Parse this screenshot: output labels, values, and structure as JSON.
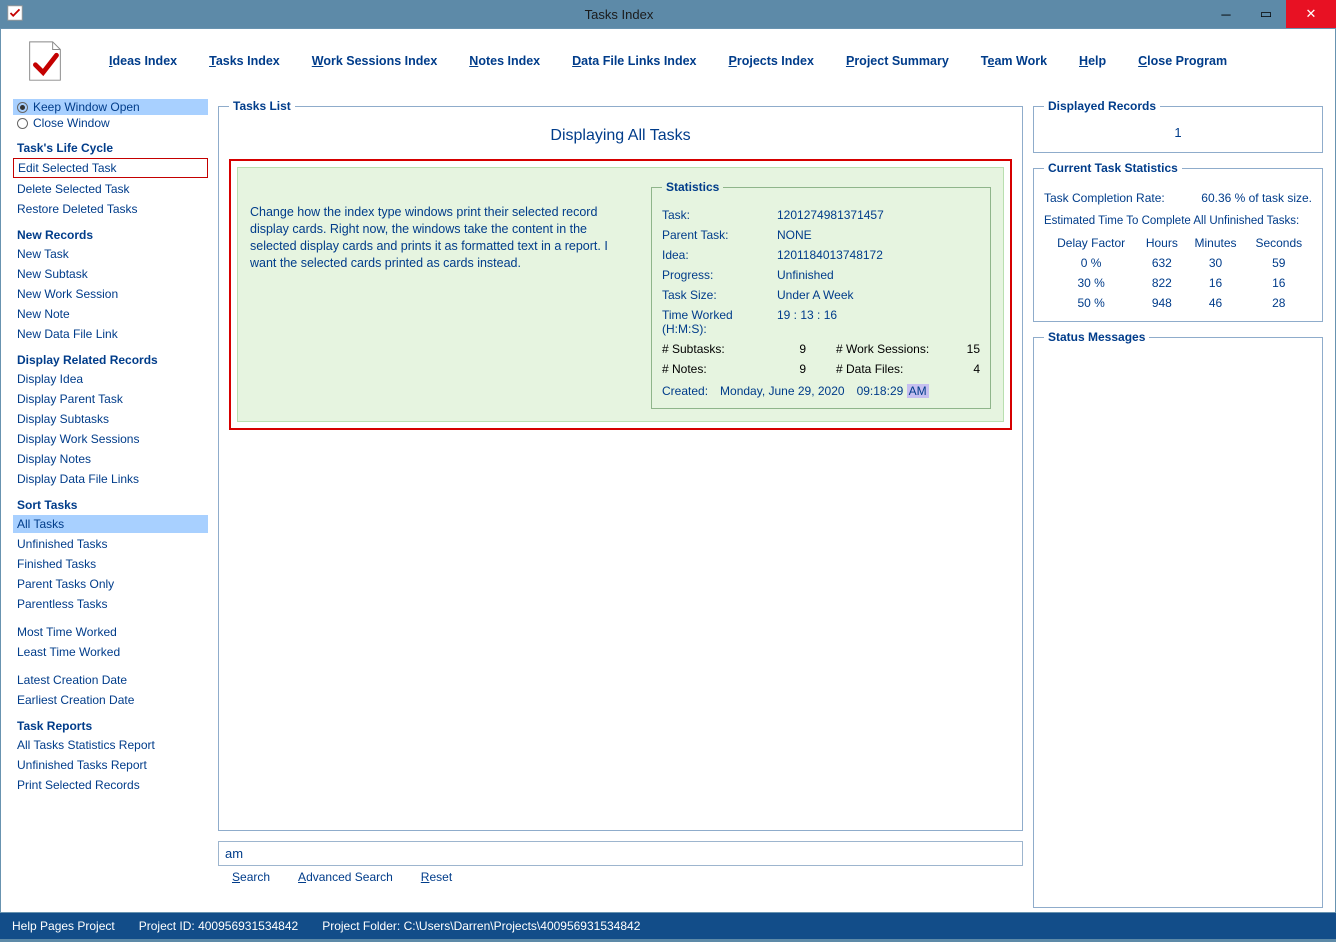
{
  "window": {
    "title": "Tasks Index"
  },
  "menu": [
    {
      "label": "Ideas Index",
      "u": "I"
    },
    {
      "label": "Tasks Index",
      "u": "T"
    },
    {
      "label": "Work Sessions Index",
      "u": "W"
    },
    {
      "label": "Notes Index",
      "u": "N"
    },
    {
      "label": "Data File Links Index",
      "u": "D"
    },
    {
      "label": "Projects Index",
      "u": "P"
    },
    {
      "label": "Project Summary",
      "u": "P"
    },
    {
      "label": "Team Work",
      "u": "e"
    },
    {
      "label": "Help",
      "u": "H"
    },
    {
      "label": "Close Program",
      "u": "C"
    }
  ],
  "sidebar": {
    "radio": {
      "keep": "Keep Window Open",
      "close": "Close Window",
      "selected": "keep"
    },
    "groups": [
      {
        "heading": "Task's Life Cycle",
        "items": [
          {
            "label": "Edit Selected Task",
            "boxed": true
          },
          {
            "label": "Delete Selected Task"
          },
          {
            "label": "Restore Deleted Tasks"
          }
        ]
      },
      {
        "heading": "New Records",
        "items": [
          {
            "label": "New Task"
          },
          {
            "label": "New Subtask"
          },
          {
            "label": "New Work Session"
          },
          {
            "label": "New Note"
          },
          {
            "label": "New Data File Link"
          }
        ]
      },
      {
        "heading": "Display Related Records",
        "items": [
          {
            "label": "Display Idea"
          },
          {
            "label": "Display Parent Task"
          },
          {
            "label": "Display Subtasks"
          },
          {
            "label": "Display Work Sessions"
          },
          {
            "label": "Display Notes"
          },
          {
            "label": "Display Data File Links"
          }
        ]
      },
      {
        "heading": "Sort Tasks",
        "items": [
          {
            "label": "All Tasks",
            "selected": true
          },
          {
            "label": "Unfinished Tasks"
          },
          {
            "label": "Finished Tasks"
          },
          {
            "label": "Parent Tasks Only"
          },
          {
            "label": "Parentless Tasks"
          }
        ]
      },
      {
        "heading": "",
        "items": [
          {
            "label": "Most Time Worked"
          },
          {
            "label": "Least Time Worked"
          }
        ]
      },
      {
        "heading": "",
        "items": [
          {
            "label": "Latest Creation Date"
          },
          {
            "label": "Earliest Creation Date"
          }
        ]
      },
      {
        "heading": "Task Reports",
        "items": [
          {
            "label": "All Tasks Statistics Report"
          },
          {
            "label": "Unfinished Tasks Report"
          },
          {
            "label": "Print Selected Records"
          }
        ]
      }
    ]
  },
  "tasksList": {
    "legend": "Tasks List",
    "title": "Displaying All Tasks",
    "cardText": "Change how the index type windows print their selected record display cards. Right now, the windows take the content in the selected display cards and prints it as formatted text in a report. I want the selected cards printed as cards instead.",
    "stats": {
      "legend": "Statistics",
      "task_lbl": "Task:",
      "task": "1201274981371457",
      "parent_lbl": "Parent Task:",
      "parent": "NONE",
      "idea_lbl": "Idea:",
      "idea": "1201184013748172",
      "progress_lbl": "Progress:",
      "progress": "Unfinished",
      "size_lbl": "Task Size:",
      "size": "Under A Week",
      "tw_lbl": "Time Worked (H:M:S):",
      "tw": "19  :  13  :  16",
      "subtasks_lbl": "# Subtasks:",
      "subtasks": "9",
      "ws_lbl": "# Work Sessions:",
      "ws": "15",
      "notes_lbl": "# Notes:",
      "notes": "9",
      "df_lbl": "# Data Files:",
      "df": "4",
      "created_lbl": "Created:",
      "created_date": "Monday, June 29, 2020",
      "created_time": "09:18:29",
      "created_ampm": "AM"
    }
  },
  "search": {
    "value": "am",
    "search": "Search",
    "advanced": "Advanced Search",
    "reset": "Reset"
  },
  "displayed": {
    "legend": "Displayed Records",
    "count": "1"
  },
  "currentStats": {
    "legend": "Current Task Statistics",
    "rate_lbl": "Task Completion Rate:",
    "rate": "60.36 % of task size.",
    "est_head": "Estimated Time To Complete All Unfinished Tasks:",
    "cols": {
      "delay": "Delay Factor",
      "hours": "Hours",
      "minutes": "Minutes",
      "seconds": "Seconds"
    },
    "rows": [
      {
        "delay": "0 %",
        "hours": "632",
        "minutes": "30",
        "seconds": "59"
      },
      {
        "delay": "30 %",
        "hours": "822",
        "minutes": "16",
        "seconds": "16"
      },
      {
        "delay": "50 %",
        "hours": "948",
        "minutes": "46",
        "seconds": "28"
      }
    ]
  },
  "statusMessages": {
    "legend": "Status Messages"
  },
  "statusbar": {
    "help": "Help Pages Project",
    "pid": "Project ID: 400956931534842",
    "folder": "Project Folder: C:\\Users\\Darren\\Projects\\400956931534842"
  }
}
